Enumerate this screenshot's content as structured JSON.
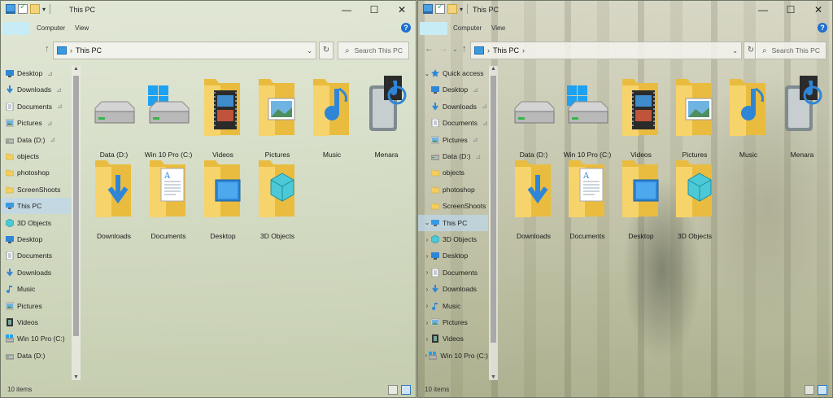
{
  "left": {
    "title": "This PC",
    "ribbon": {
      "tabs": [
        "Computer",
        "View"
      ]
    },
    "address": {
      "path": "This PC",
      "search_placeholder": "Search This PC"
    },
    "nav": [
      {
        "label": "Desktop",
        "icon": "desktop-icon",
        "pinned": true
      },
      {
        "label": "Downloads",
        "icon": "downloads-icon",
        "pinned": true
      },
      {
        "label": "Documents",
        "icon": "documents-icon",
        "pinned": true
      },
      {
        "label": "Pictures",
        "icon": "pictures-icon",
        "pinned": true
      },
      {
        "label": "Data (D:)",
        "icon": "drive-icon",
        "pinned": true
      },
      {
        "label": "objects",
        "icon": "folder-icon"
      },
      {
        "label": "photoshop",
        "icon": "folder-icon"
      },
      {
        "label": "ScreenShoots",
        "icon": "folder-icon"
      },
      {
        "label": "This PC",
        "icon": "this-pc-icon",
        "selected": true
      },
      {
        "label": "3D Objects",
        "icon": "3d-objects-icon"
      },
      {
        "label": "Desktop",
        "icon": "desktop-icon"
      },
      {
        "label": "Documents",
        "icon": "documents-icon"
      },
      {
        "label": "Downloads",
        "icon": "downloads-icon"
      },
      {
        "label": "Music",
        "icon": "music-icon"
      },
      {
        "label": "Pictures",
        "icon": "pictures-icon"
      },
      {
        "label": "Videos",
        "icon": "videos-icon"
      },
      {
        "label": "Win 10 Pro (C:)",
        "icon": "windows-drive-icon"
      },
      {
        "label": "Data (D:)",
        "icon": "drive-icon"
      }
    ],
    "status": "10 items"
  },
  "right": {
    "title": "This PC",
    "ribbon": {
      "tabs": [
        "Computer",
        "View"
      ]
    },
    "address": {
      "path": "This PC",
      "search_placeholder": "Search This PC"
    },
    "nav": [
      {
        "label": "Quick access",
        "icon": "star-icon",
        "chevron": "expanded"
      },
      {
        "label": "Desktop",
        "icon": "desktop-icon",
        "pinned": true
      },
      {
        "label": "Downloads",
        "icon": "downloads-icon",
        "pinned": true
      },
      {
        "label": "Documents",
        "icon": "documents-icon",
        "pinned": true
      },
      {
        "label": "Pictures",
        "icon": "pictures-icon",
        "pinned": true
      },
      {
        "label": "Data (D:)",
        "icon": "drive-icon",
        "pinned": true
      },
      {
        "label": "objects",
        "icon": "folder-icon"
      },
      {
        "label": "photoshop",
        "icon": "folder-icon"
      },
      {
        "label": "ScreenShoots",
        "icon": "folder-icon"
      },
      {
        "label": "This PC",
        "icon": "this-pc-icon",
        "chevron": "expanded",
        "selected": true
      },
      {
        "label": "3D Objects",
        "icon": "3d-objects-icon",
        "chevron": "collapsed"
      },
      {
        "label": "Desktop",
        "icon": "desktop-icon",
        "chevron": "collapsed"
      },
      {
        "label": "Documents",
        "icon": "documents-icon",
        "chevron": "collapsed"
      },
      {
        "label": "Downloads",
        "icon": "downloads-icon",
        "chevron": "collapsed"
      },
      {
        "label": "Music",
        "icon": "music-icon",
        "chevron": "collapsed"
      },
      {
        "label": "Pictures",
        "icon": "pictures-icon",
        "chevron": "collapsed"
      },
      {
        "label": "Videos",
        "icon": "videos-icon",
        "chevron": "collapsed"
      },
      {
        "label": "Win 10 Pro (C:)",
        "icon": "windows-drive-icon",
        "chevron": "collapsed"
      }
    ],
    "status": "10 items"
  },
  "items": [
    {
      "label": "Data (D:)",
      "icon": "drive-icon"
    },
    {
      "label": "Win 10 Pro (C:)",
      "icon": "windows-drive-icon"
    },
    {
      "label": "Videos",
      "icon": "videos-folder-icon"
    },
    {
      "label": "Pictures",
      "icon": "pictures-folder-icon"
    },
    {
      "label": "Music",
      "icon": "music-folder-icon"
    },
    {
      "label": "Menara",
      "icon": "media-device-icon"
    },
    {
      "label": "Downloads",
      "icon": "downloads-folder-icon"
    },
    {
      "label": "Documents",
      "icon": "documents-folder-icon"
    },
    {
      "label": "Desktop",
      "icon": "desktop-folder-icon"
    },
    {
      "label": "3D Objects",
      "icon": "3d-objects-folder-icon"
    }
  ],
  "colors": {
    "selection": "#bed7eb",
    "accent": "#1e6fd0",
    "folder": "#f3cd5e"
  }
}
